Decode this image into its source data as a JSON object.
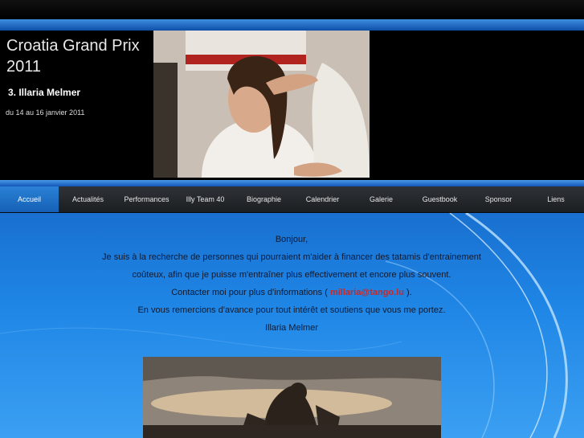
{
  "header": {
    "site_title": "Croatia Grand Prix 2011",
    "headline": "3. Illaria Melmer",
    "date": "du 14 au 16 janvier 2011"
  },
  "nav": {
    "items": [
      {
        "label": "Accueil",
        "active": true
      },
      {
        "label": "Actualités",
        "active": false
      },
      {
        "label": "Performances",
        "active": false
      },
      {
        "label": "Illy Team 40",
        "active": false
      },
      {
        "label": "Biographie",
        "active": false
      },
      {
        "label": "Calendrier",
        "active": false
      },
      {
        "label": "Galerie",
        "active": false
      },
      {
        "label": "Guestbook",
        "active": false
      },
      {
        "label": "Sponsor",
        "active": false
      },
      {
        "label": "Liens",
        "active": false
      }
    ]
  },
  "content": {
    "greeting": "Bonjour,",
    "line1": "Je suis à la recherche de personnes qui pourraient m'aider à financer des tatamis d'entrainement",
    "line2": "coûteux, afin que je puisse m'entraîner plus effectivement et encore plus souvent.",
    "contact_prefix": "Contacter moi pour plus d'informations (",
    "contact_email": "millaria@tango.lu",
    "contact_suffix": ").",
    "thanks": "En vous remercions d'avance pour tout intérêt et soutiens que vous me portez.",
    "signature": "Illaria Melmer"
  },
  "colors": {
    "active_tab": "#1f74c9",
    "link": "#c62828",
    "background": "#1667c6"
  }
}
